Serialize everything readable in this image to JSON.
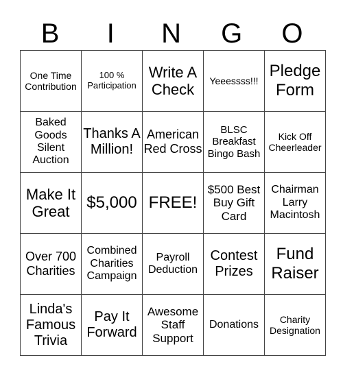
{
  "header": [
    "B",
    "I",
    "N",
    "G",
    "O"
  ],
  "rows": [
    [
      "One Time Contribution",
      "100 % Participation",
      "Write A Check",
      "Yeeessss!!!",
      "Pledge Form"
    ],
    [
      "Baked Goods Silent Auction",
      "Thanks A Million!",
      "American Red Cross",
      "BLSC Breakfast Bingo Bash",
      "Kick Off Cheerleader"
    ],
    [
      "Make It Great",
      "$5,000",
      "FREE!",
      "$500 Best Buy Gift Card",
      "Chairman Larry Macintosh"
    ],
    [
      "Over 700 Charities",
      "Combined Charities Campaign",
      "Payroll Deduction",
      "Contest Prizes",
      "Fund Raiser"
    ],
    [
      "Linda's Famous Trivia",
      "Pay It Forward",
      "Awesome Staff Support",
      "Donations",
      "Charity Designation"
    ]
  ]
}
